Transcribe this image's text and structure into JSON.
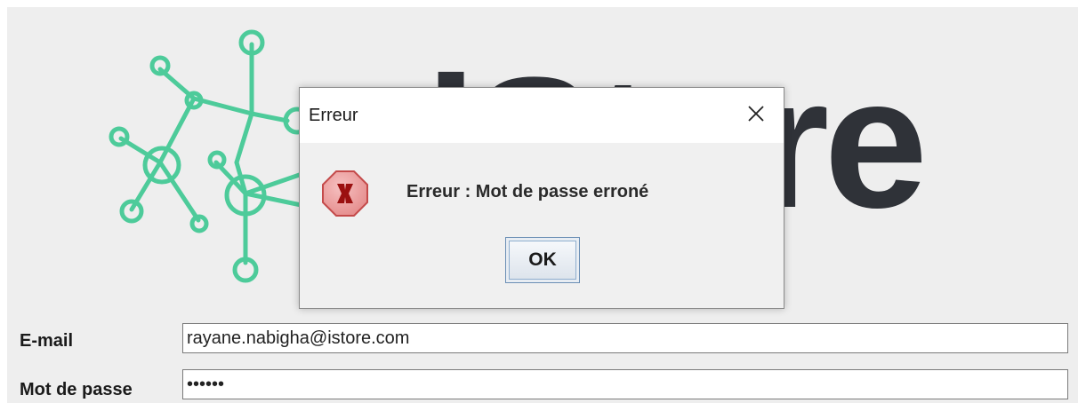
{
  "app": {
    "logo_text": "iStore",
    "logo_color": "#2f3238",
    "logo_accent": "#4dcb9a"
  },
  "form": {
    "email_label": "E-mail",
    "email_value": "rayane.nabigha@istore.com",
    "password_label": "Mot de passe",
    "password_value": "••••••"
  },
  "dialog": {
    "title": "Erreur",
    "message": "Erreur : Mot de passe erroné",
    "ok_label": "OK",
    "icon": "error-stop-icon",
    "close_icon": "close-icon"
  }
}
